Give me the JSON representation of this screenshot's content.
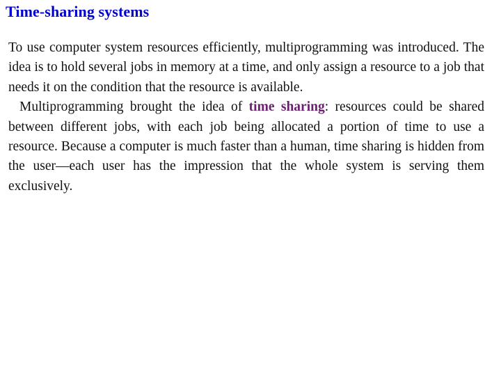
{
  "slide": {
    "title": "Time-sharing systems",
    "paragraph1": "To use computer system resources efficiently, multiprogramming was introduced. The idea is to hold several jobs in memory at a time, and only assign a resource to a job that needs it on the condition that the resource is available.",
    "paragraph2": {
      "before": "Multiprogramming brought the idea of ",
      "term": "time sharing",
      "after": ": resources could be shared between different jobs, with each job being allocated a portion of time to use a resource. Because a computer is much faster than a human, time sharing is hidden from the user—each user has the impression that the whole system is serving them exclusively."
    }
  },
  "colors": {
    "title": "#0000cc",
    "term_highlight": "#6b1f6e",
    "body_text": "#111111",
    "background": "#ffffff"
  }
}
